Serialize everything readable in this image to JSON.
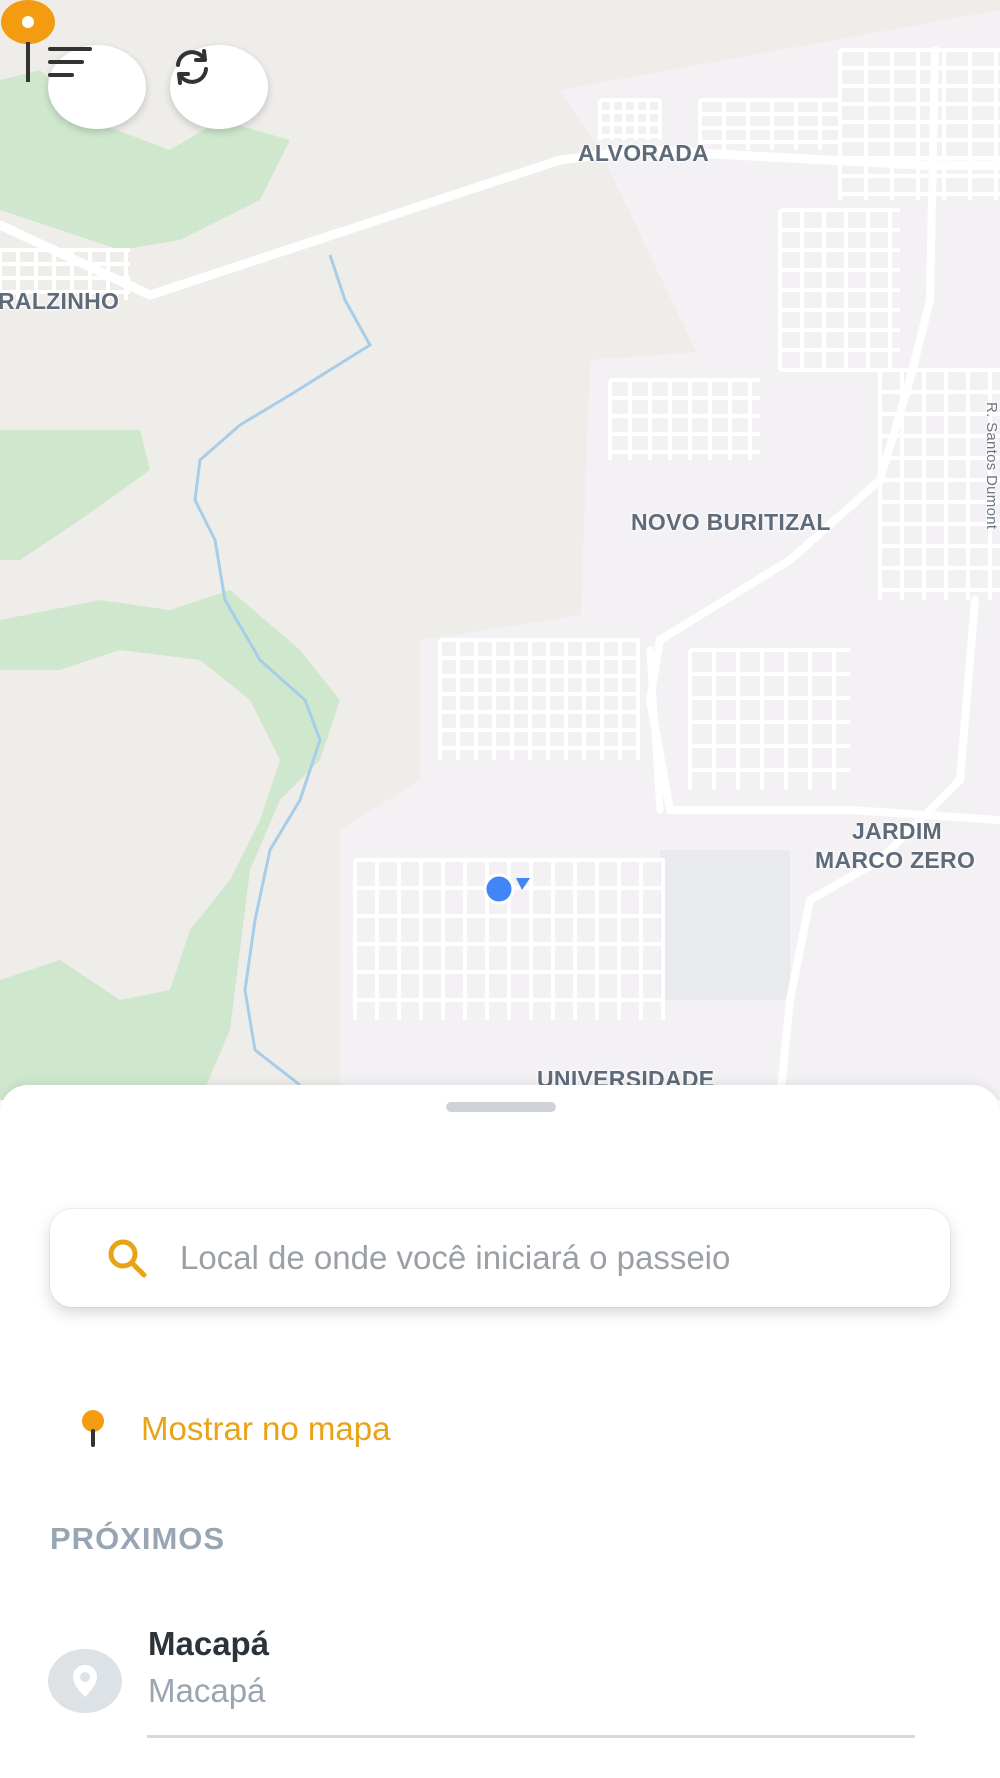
{
  "map": {
    "labels": {
      "alvorada": "ALVORADA",
      "buritizal": "RALZINHO",
      "novo_buritizal": "NOVO BURITIZAL",
      "jardim_line1": "JARDIM",
      "jardim_line2": "MARCO ZERO",
      "universidade": "UNIVERSIDADE",
      "street": "R. Santos Dumont"
    },
    "menu_icon": "menu-icon",
    "refresh_icon": "refresh-icon",
    "colors": {
      "background": "#efedea",
      "park": "#cfe8cd",
      "water": "#a8cde8",
      "road": "#ffffff",
      "pin": "#f39c12",
      "location_dot": "#4285f4"
    }
  },
  "sheet": {
    "search": {
      "icon": "search-icon",
      "placeholder": "Local de onde você iniciará o passeio"
    },
    "show_on_map": {
      "icon": "map-pin-icon",
      "label": "Mostrar no mapa"
    },
    "nearby": {
      "title": "PRÓXIMOS",
      "items": [
        {
          "icon": "location-icon",
          "title": "Macapá",
          "subtitle": "Macapá"
        }
      ]
    },
    "accent_color": "#e8a317"
  }
}
